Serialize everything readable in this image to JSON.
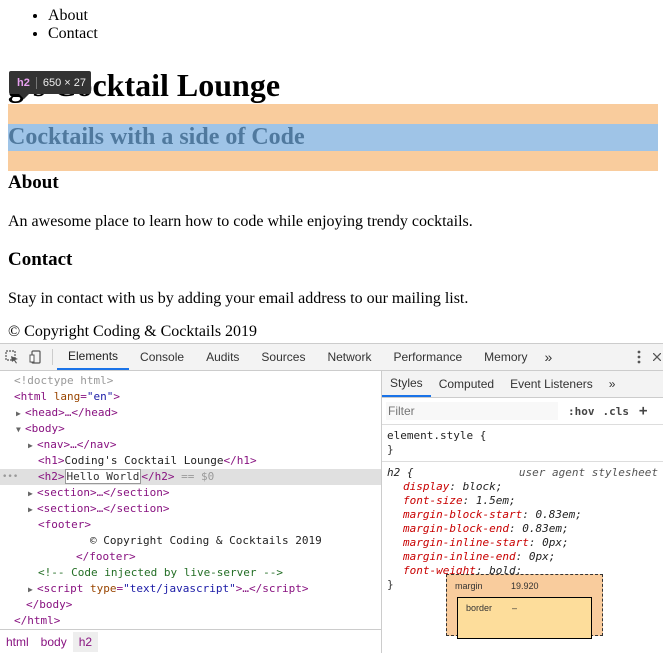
{
  "page": {
    "nav_items": [
      "About",
      "Contact"
    ],
    "h1_visible": "g's Cocktail Lounge",
    "h2": "Cocktails with a side of Code",
    "about_heading": "About",
    "about_text": "An awesome place to learn how to code while enjoying trendy cocktails.",
    "contact_heading": "Contact",
    "contact_text": "Stay in contact with us by adding your email address to our mailing list.",
    "footer_text": "© Copyright Coding & Cocktails 2019",
    "tooltip": {
      "tag": "h2",
      "dims": "650 × 27"
    }
  },
  "devtools": {
    "tabs": [
      "Elements",
      "Console",
      "Audits",
      "Sources",
      "Network",
      "Performance",
      "Memory"
    ],
    "more": "»",
    "dom": {
      "doctype": "<!doctype html>",
      "html_open": "html",
      "lang_attr": "lang",
      "lang_val": "\"en\"",
      "head": "<head>…</head>",
      "body_open": "<body>",
      "nav": "<nav>…</nav>",
      "h1_text": "Coding's Cocktail Lounge",
      "h2_edit": "Hello World",
      "h2_suffix": "== $0",
      "section": "<section>…</section>",
      "footer_open": "<footer>",
      "footer_text": "© Copyright Coding & Cocktails 2019",
      "footer_close": "</footer>",
      "comment": "<!-- Code injected by live-server -->",
      "script_type": "\"text/javascript\"",
      "body_close": "</body>",
      "html_close": "</html>",
      "ellipsis_dots": "•••"
    },
    "breadcrumbs": [
      "html",
      "body",
      "h2"
    ],
    "styles": {
      "tabs": [
        "Styles",
        "Computed",
        "Event Listeners"
      ],
      "filter_placeholder": "Filter",
      "hov": ":hov",
      "cls": ".cls",
      "plus": "+",
      "element_style": "element.style {",
      "close_brace": "}",
      "h2_selector": "h2 {",
      "ua_label": "user agent stylesheet",
      "declarations": [
        {
          "name": "display",
          "value": "block;"
        },
        {
          "name": "font-size",
          "value": "1.5em;"
        },
        {
          "name": "margin-block-start",
          "value": "0.83em;"
        },
        {
          "name": "margin-block-end",
          "value": "0.83em;"
        },
        {
          "name": "margin-inline-start",
          "value": "0px;"
        },
        {
          "name": "margin-inline-end",
          "value": "0px;"
        },
        {
          "name": "font-weight",
          "value": "bold;"
        }
      ],
      "box": {
        "margin_label": "margin",
        "margin_value": "19.920",
        "border_label": "border",
        "border_value": "–"
      }
    }
  },
  "colors": {
    "margin": "#f9cc9d",
    "content": "#9fc4e7",
    "accent": "#1a73e8"
  }
}
